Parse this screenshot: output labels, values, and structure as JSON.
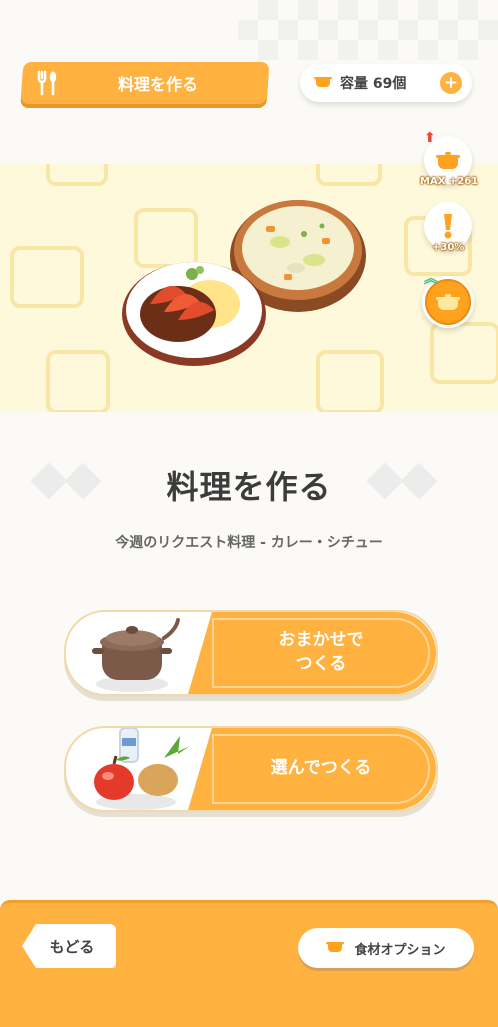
{
  "header": {
    "title": "料理を作る",
    "capacity_label": "容量 69個",
    "plus": "+"
  },
  "side_buttons": [
    {
      "icon": "pot-max-icon",
      "caption": "MAX +261"
    },
    {
      "icon": "exclamation-icon",
      "caption": "+30%"
    },
    {
      "icon": "golden-pot-icon",
      "caption": ""
    }
  ],
  "main": {
    "heading": "料理を作る",
    "subheading": "今週のリクエスト料理 - カレー・シチュー"
  },
  "actions": [
    {
      "label_line1": "おまかせで",
      "label_line2": "つくる",
      "icon": "cooking-pot-icon"
    },
    {
      "label": "選んでつくる",
      "icon": "ingredients-icon"
    }
  ],
  "footer": {
    "back_label": "もどる",
    "ingredient_option_label": "食材オプション"
  },
  "colors": {
    "accent": "#ffb240",
    "banner_bg": "#fff9dc",
    "text_dark": "#3c3c3c"
  }
}
